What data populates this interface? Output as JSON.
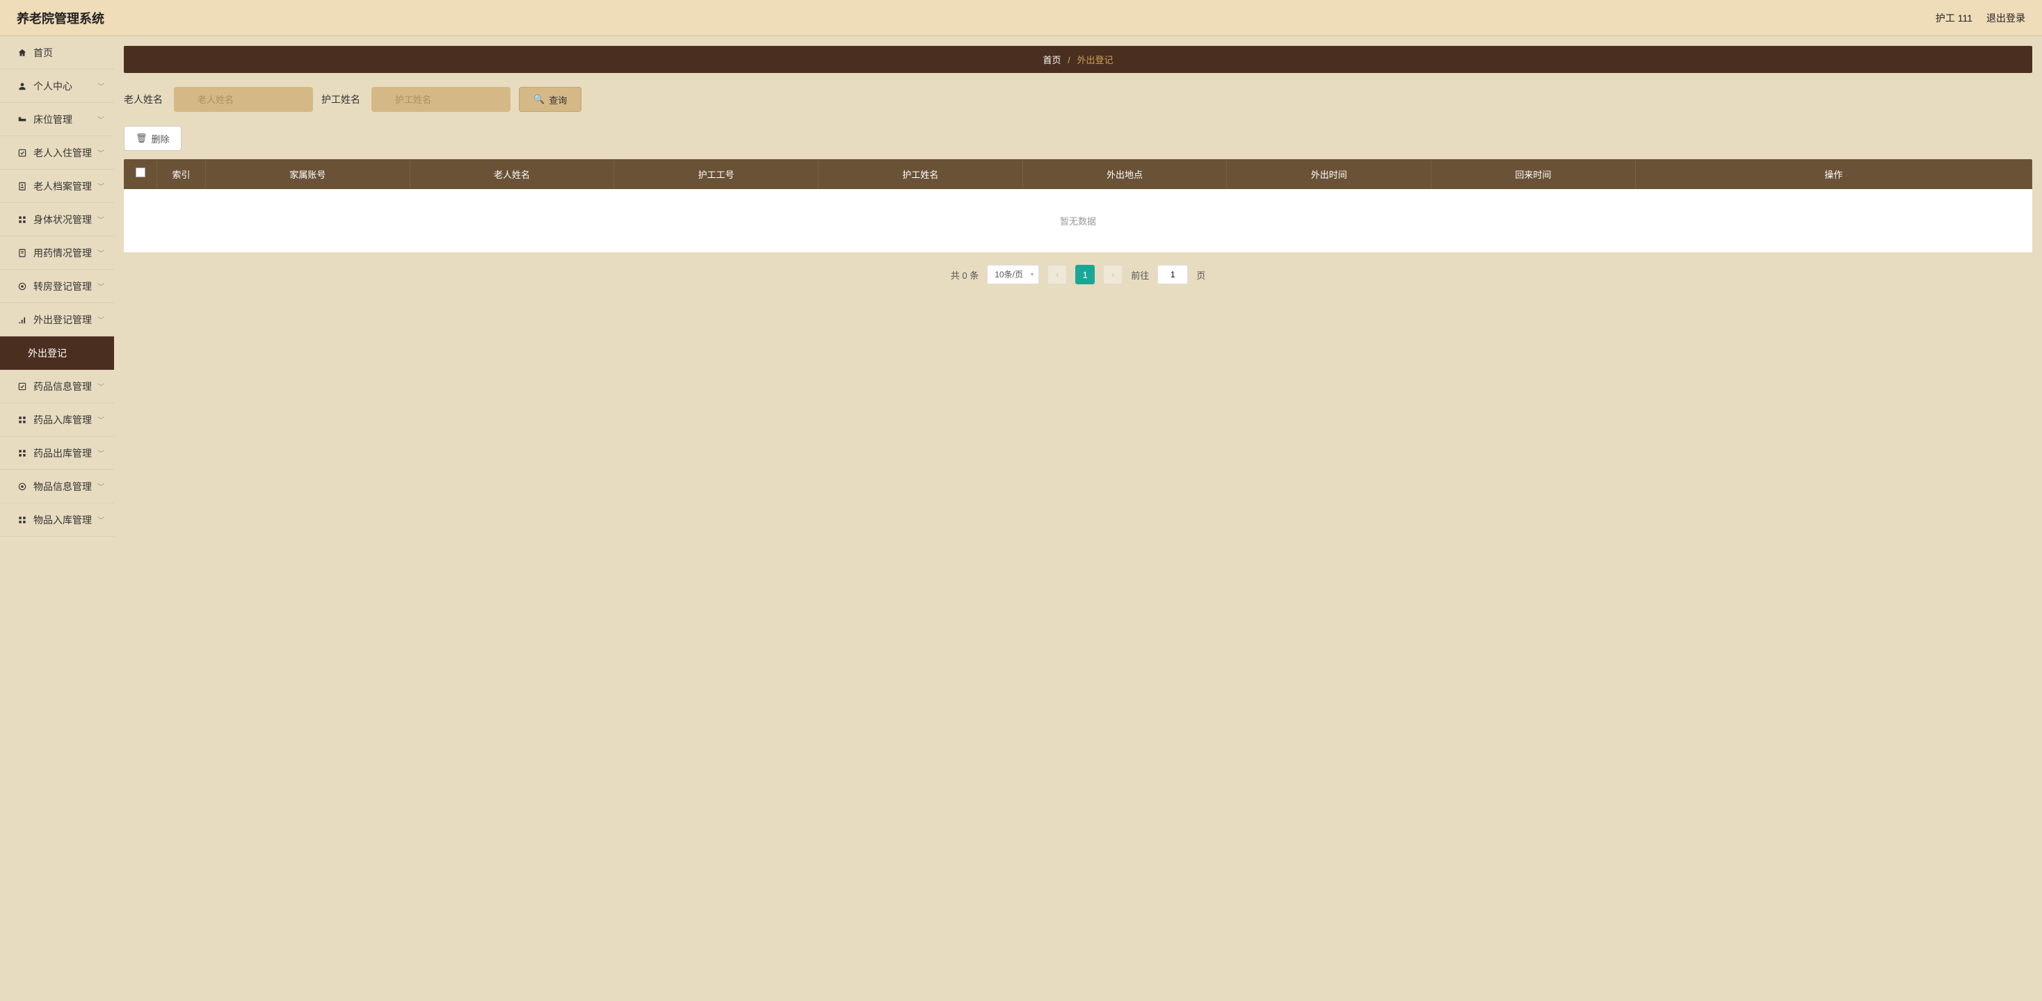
{
  "header": {
    "title": "养老院管理系统",
    "user": "护工 111",
    "logout": "退出登录"
  },
  "sidebar": {
    "items": [
      {
        "icon": "home",
        "label": "首页",
        "expandable": false
      },
      {
        "icon": "user",
        "label": "个人中心",
        "expandable": true
      },
      {
        "icon": "bed",
        "label": "床位管理",
        "expandable": true
      },
      {
        "icon": "checkin",
        "label": "老人入住管理",
        "expandable": true
      },
      {
        "icon": "profile",
        "label": "老人档案管理",
        "expandable": true
      },
      {
        "icon": "health",
        "label": "身体状况管理",
        "expandable": true
      },
      {
        "icon": "medicine",
        "label": "用药情况管理",
        "expandable": true
      },
      {
        "icon": "room",
        "label": "转房登记管理",
        "expandable": true
      },
      {
        "icon": "out",
        "label": "外出登记管理",
        "expandable": true
      },
      {
        "icon": "",
        "label": "外出登记",
        "expandable": false,
        "sub": true
      },
      {
        "icon": "druginfo",
        "label": "药品信息管理",
        "expandable": true
      },
      {
        "icon": "drugin",
        "label": "药品入库管理",
        "expandable": true
      },
      {
        "icon": "drugout",
        "label": "药品出库管理",
        "expandable": true
      },
      {
        "icon": "goods",
        "label": "物品信息管理",
        "expandable": true
      },
      {
        "icon": "goodsin",
        "label": "物品入库管理",
        "expandable": true
      }
    ]
  },
  "breadcrumb": {
    "home": "首页",
    "sep": "/",
    "current": "外出登记"
  },
  "search": {
    "field1_label": "老人姓名",
    "field1_placeholder": "老人姓名",
    "field2_label": "护工姓名",
    "field2_placeholder": "护工姓名",
    "query_btn": "查询"
  },
  "actions": {
    "delete": "删除"
  },
  "table": {
    "headers": [
      "索引",
      "家属账号",
      "老人姓名",
      "护工工号",
      "护工姓名",
      "外出地点",
      "外出时间",
      "回来时间",
      "操作"
    ],
    "empty": "暂无数据"
  },
  "pagination": {
    "total_text": "共 0 条",
    "per_page": "10条/页",
    "current": "1",
    "goto_prefix": "前往",
    "goto_value": "1",
    "goto_suffix": "页"
  }
}
